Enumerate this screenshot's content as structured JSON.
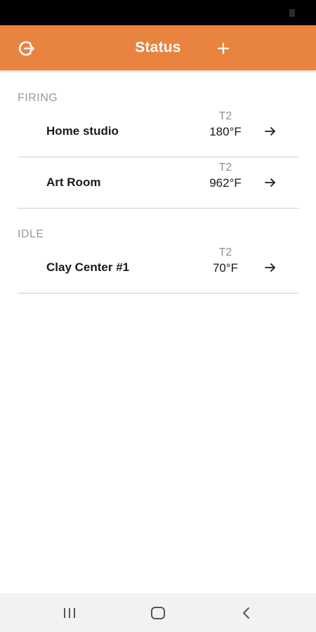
{
  "header": {
    "title": "Status",
    "left_icon": "logout-icon",
    "right_icon": "plus-icon",
    "background": "#e8843f"
  },
  "sections": [
    {
      "label": "FIRING",
      "rows": [
        {
          "name": "Home studio",
          "temp_label": "T2",
          "temp": "180°F"
        },
        {
          "name": "Art Room",
          "temp_label": "T2",
          "temp": "962°F"
        }
      ]
    },
    {
      "label": "IDLE",
      "rows": [
        {
          "name": "Clay Center #1",
          "temp_label": "T2",
          "temp": "70°F"
        }
      ]
    }
  ],
  "navigation": {
    "icons": [
      "recent-apps-icon",
      "home-icon",
      "back-icon"
    ]
  }
}
